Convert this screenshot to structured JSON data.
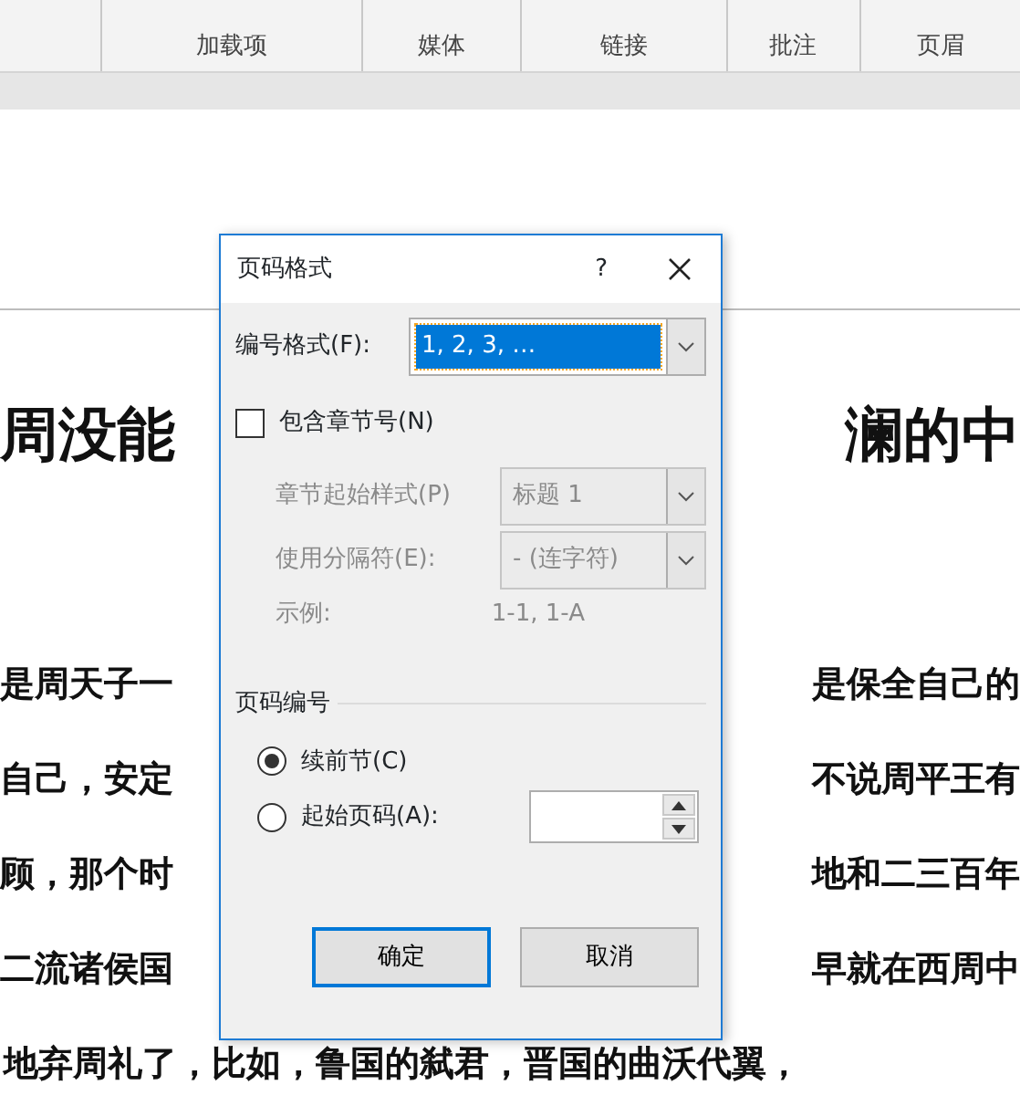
{
  "ribbon": {
    "groups": [
      {
        "label": "加载项"
      },
      {
        "label": "媒体"
      },
      {
        "label": "链接"
      },
      {
        "label": "批注"
      },
      {
        "label": "页眉"
      }
    ]
  },
  "document": {
    "heading": {
      "left": "周没能",
      "right": "澜的中"
    },
    "lines": [
      {
        "left": "是周天子一",
        "right": "是保全自己的"
      },
      {
        "left": "自己，安定",
        "right": "不说周平王有"
      },
      {
        "left": "顾，那个时",
        "right": "地和二三百年"
      },
      {
        "left": "二流诸侯国",
        "right": "早就在西周中"
      },
      {
        "left": "地弃周礼了，比如，鲁国的弑君，晋国的曲沃代翼，"
      }
    ]
  },
  "dialog": {
    "title": "页码格式",
    "help": "?",
    "number_format": {
      "label": "编号格式(F):",
      "value": "1, 2, 3, …"
    },
    "include_chapter": {
      "label": "包含章节号(N)",
      "checked": false
    },
    "chapter_fields": [
      {
        "label": "章节起始样式(P)",
        "value": "标题 1",
        "disabled": true
      },
      {
        "label": "使用分隔符(E):",
        "value": "-  (连字符)",
        "disabled": true
      }
    ],
    "example": {
      "label": "示例:",
      "value": "1-1, 1-A"
    },
    "numbering": {
      "title": "页码编号",
      "options": [
        {
          "label": "续前节(C)",
          "selected": true,
          "kind": "plain"
        },
        {
          "label": "起始页码(A):",
          "selected": false,
          "kind": "spinner"
        }
      ]
    },
    "buttons": [
      {
        "label": "确定",
        "default": true
      },
      {
        "label": "取消",
        "default": false
      }
    ]
  }
}
